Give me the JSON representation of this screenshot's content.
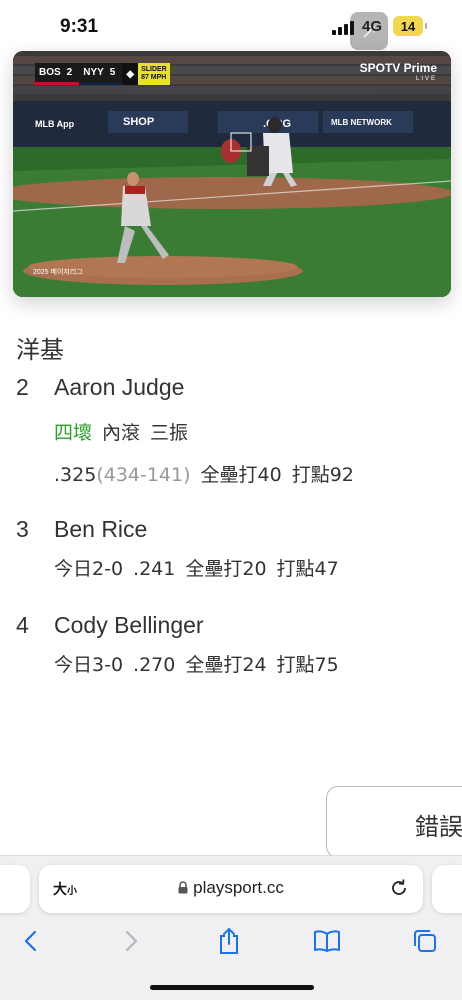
{
  "status_bar": {
    "time": "9:31",
    "network": "4G",
    "battery": "14"
  },
  "video": {
    "score": {
      "away_team": "BOS",
      "away_score": "2",
      "home_team": "NYY",
      "home_score": "5",
      "pitch_type": "SLIDER",
      "pitch_speed": "87 MPH"
    },
    "broadcaster": "SPOTV Prime",
    "broadcaster_sub": "LIVE",
    "league_tag": "2025 메이저리그"
  },
  "team": "洋基",
  "batters": [
    {
      "order": "2",
      "name": "Aaron Judge",
      "events": [
        {
          "text": "四壞",
          "highlight": true
        },
        {
          "text": "內滾",
          "highlight": false
        },
        {
          "text": "三振",
          "highlight": false
        }
      ],
      "avg": ".325",
      "ab_h": "(434-141)",
      "hr": "全壘打40",
      "rbi": "打點92"
    },
    {
      "order": "3",
      "name": "Ben Rice",
      "today": "今日2-0",
      "avg": ".241",
      "hr": "全壘打20",
      "rbi": "打點47"
    },
    {
      "order": "4",
      "name": "Cody Bellinger",
      "today": "今日3-0",
      "avg": ".270",
      "hr": "全壘打24",
      "rbi": "打點75"
    }
  ],
  "error_button": "錯誤",
  "browser": {
    "text_size_big": "大",
    "text_size_small": "小",
    "url": "playsport.cc"
  },
  "colors": {
    "highlight_green": "#2ba02b",
    "ios_blue": "#1a73e8"
  }
}
